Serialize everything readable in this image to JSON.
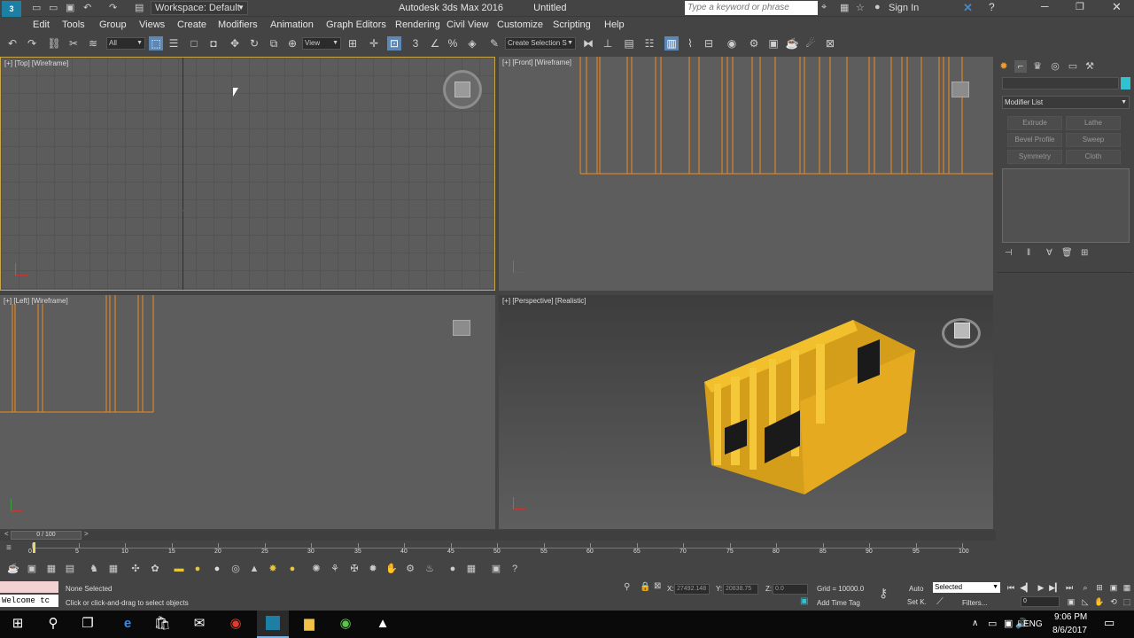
{
  "window": {
    "app_title": "Autodesk 3ds Max 2016",
    "doc_title": "Untitled",
    "workspace": "Workspace: Default",
    "search_placeholder": "Type a keyword or phrase",
    "sign_in": "Sign In"
  },
  "menu": [
    "Edit",
    "Tools",
    "Group",
    "Views",
    "Create",
    "Modifiers",
    "Animation",
    "Graph Editors",
    "Rendering",
    "Civil View",
    "Customize",
    "Scripting",
    "Help"
  ],
  "toolbar": {
    "selection_filter": "All",
    "ref_coord": "View",
    "named_selection": "Create Selection S"
  },
  "viewports": {
    "top": "[+] [Top] [Wireframe]",
    "front": "[+] [Front] [Wireframe]",
    "left": "[+] [Left] [Wireframe]",
    "perspective": "[+] [Perspective] [Realistic]"
  },
  "command_panel": {
    "modifier_list": "Modifier List",
    "buttons": [
      "Extrude",
      "Lathe",
      "Bevel Profile",
      "Sweep",
      "Symmetry",
      "Cloth"
    ]
  },
  "timeline": {
    "frame_display": "0 / 100",
    "ticks": [
      "0",
      "5",
      "10",
      "15",
      "20",
      "25",
      "30",
      "35",
      "40",
      "45",
      "50",
      "55",
      "60",
      "65",
      "70",
      "75",
      "80",
      "85",
      "90",
      "95",
      "100"
    ]
  },
  "status": {
    "maxscript": "Welcome tc",
    "selection": "None Selected",
    "prompt": "Click or click-and-drag to select objects",
    "x_label": "X:",
    "x_value": "27492.148",
    "y_label": "Y:",
    "y_value": "20838.75",
    "z_label": "Z:",
    "z_value": "0.0",
    "grid": "Grid = 10000.0",
    "add_time_tag": "Add Time Tag",
    "auto": "Auto",
    "set_key": "Set K.",
    "selected_dropdown": "Selected",
    "filters": "Filters...",
    "frame": "0"
  },
  "taskbar": {
    "lang": "ENG",
    "time": "9:06 PM",
    "date": "8/6/2017"
  }
}
